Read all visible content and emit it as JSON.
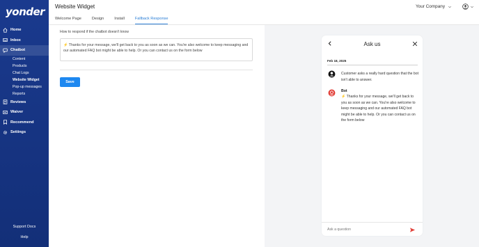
{
  "sidebar": {
    "logo": "yonder",
    "nav": [
      {
        "label": "Home",
        "icon": "home-icon"
      },
      {
        "label": "Inbox",
        "icon": "inbox-icon"
      },
      {
        "label": "Chatbot",
        "icon": "chat-icon"
      }
    ],
    "chatbot_sub": [
      "Content",
      "Products",
      "Chat Logs",
      "Website Widget",
      "Pop-up messages",
      "Reports"
    ],
    "nav2": [
      {
        "label": "Reviews",
        "icon": "reviews-icon"
      },
      {
        "label": "Waiver",
        "icon": "waiver-icon"
      },
      {
        "label": "Recommend",
        "icon": "recommend-icon"
      },
      {
        "label": "Settings",
        "icon": "gear-icon"
      }
    ],
    "support_docs": "Support Docs",
    "help": "Help"
  },
  "header": {
    "title": "Website Widget",
    "tabs": [
      "Welcome Page",
      "Design",
      "Install",
      "Fallback Response"
    ],
    "active_tab": "Fallback Response",
    "company": "Your Company"
  },
  "form": {
    "label": "How to respond if the chatbot doesn't know",
    "value": "⚡ Thanks for your message, we'll get back to you as soon as we can. You're also welcome to keep messaging and our automated FAQ bot might be able to help. Or you can contact us on the form below",
    "save_label": "Save"
  },
  "preview": {
    "title": "Ask us",
    "date": "Feb 18, 2025",
    "user_message": "Customer asks a really hard question that the bot isn't able to answer.",
    "bot_name": "Bot",
    "bot_message": "⚡ Thanks for your message, we'll get back to you as soon as we can. You're also welcome to keep messaging and our automated FAQ bot might be able to help. Or you can contact us on the form below",
    "input_placeholder": "Ask a question"
  },
  "colors": {
    "sidebar": "#1a3a8e",
    "accent": "#1e88f0",
    "bot_avatar": "#e2413a"
  }
}
